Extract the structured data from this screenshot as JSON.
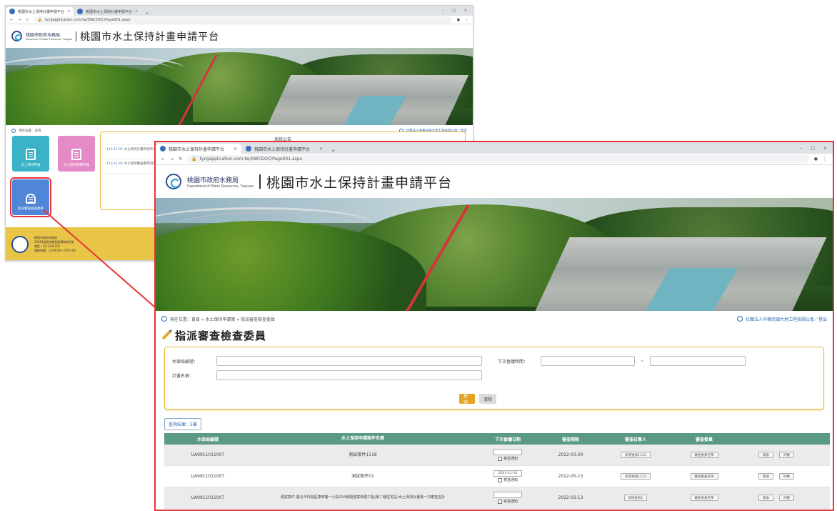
{
  "back": {
    "tabs": [
      {
        "label": "桃園市水土保持計畫申請平台"
      },
      {
        "label": "桃園市水土保持計畫申請平台"
      }
    ],
    "url": "tycgapplication.com.tw/SWCDOC/Page001.aspx",
    "logo_cn": "桃園市政府水務局",
    "logo_en": "Department of Water Resources, Taoyuan",
    "site_title": "桃園市水土保持計畫申請平台",
    "crumb_left": "現在位置：首頁",
    "crumb_right": "社團法人中華民國大地工程技師公會／登出",
    "tiles": [
      {
        "label": "水土保持申請"
      },
      {
        "label": "水土保持規劃申報"
      },
      {
        "label": "指派審查檢查委員"
      }
    ],
    "announce_title": "系統公告",
    "announcements": [
      {
        "date": "110-11-01",
        "text": "水土保持計畫申請作業流程說明"
      },
      {
        "date": "110-11-01",
        "text": "水土保持審查費用說明"
      }
    ],
    "footer_lines": [
      "桃園市政府水務局",
      "33001桃園市桃園區縣府路1號",
      "電話：03-3322101",
      "服務時間：上午8:00～下午5:00"
    ]
  },
  "front": {
    "tabs": [
      {
        "label": "桃園市水土保持計畫申請平台"
      },
      {
        "label": "桃園市水土保持計畫申請平台"
      }
    ],
    "url": "tycgapplication.com.tw/SWCDOC/Page001.aspx",
    "logo_cn": "桃園市政府水務局",
    "logo_en": "Department of Water Resources, Taoyuan",
    "site_title": "桃園市水土保持計畫申請平台",
    "crumb_left": "現在位置：首頁 » 水土保持申請案 » 指派審查檢查委員",
    "crumb_right": "社團法人中華民國大地工程技師公會／登出",
    "page_title": "指派審查檢查委員",
    "search": {
      "case_no_label": "水保局編號：",
      "plan_name_label": "計畫名稱：",
      "date_label": "下次會議時間：",
      "tilde": "~",
      "query_label": "查詢",
      "clear_label": "清除"
    },
    "result_count": "查詢結果：5筆",
    "table": {
      "headers": [
        "水保局編號",
        "水土保持申請案件名稱",
        "下次會議日期",
        "審查期限",
        "審查召集人",
        "審查委員",
        ""
      ],
      "rows": [
        {
          "case_no": "UA9911011007",
          "name": "測試案件1118",
          "meeting_date": "",
          "notice": "寄送通知",
          "deadline": "2022-03-20",
          "convener": "新增委員1123",
          "member": "審查委員名單",
          "act1": "簽收",
          "act2": "評審"
        },
        {
          "case_no": "UA9911011007",
          "name": "測試案件01",
          "meeting_date": "2021-11-16",
          "notice": "寄送通知",
          "deadline": "2022-05-15",
          "convener": "新增委員1123",
          "member": "審查委員名單",
          "act1": "簽收",
          "act2": "評審"
        },
        {
          "case_no": "UA9911011007",
          "name": "測試案件-臺北市內湖區康寧路一小段254號開發案新建工程(第二種住宅區)水土保持計畫書一次審查設計",
          "meeting_date": "",
          "notice": "寄送通知",
          "deadline": "2022-02-13",
          "convener": "新增委員1",
          "member": "審查委員名單",
          "act1": "簽收",
          "act2": "評審"
        }
      ]
    }
  }
}
